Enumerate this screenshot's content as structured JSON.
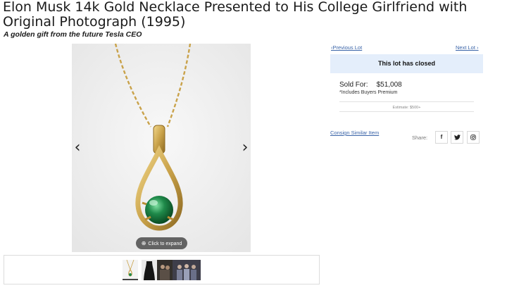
{
  "lot": {
    "title": "Elon Musk 14k Gold Necklace Presented to His College Girlfriend with Original Photograph (1995)",
    "subtitle": "A golden gift from the future Tesla CEO"
  },
  "gallery": {
    "prev_arrow": "‹",
    "next_arrow": "›",
    "expand_icon": "⊕",
    "expand_label": "Click to expand",
    "thumbnails": [
      "necklace-on-white",
      "necklace-on-bust",
      "photo-dark-1",
      "photo-group"
    ]
  },
  "sidebar": {
    "previous_lot": "Previous Lot",
    "next_lot": "Next Lot",
    "prev_chevron": "‹",
    "next_chevron": "›",
    "status": "This lot has closed",
    "sold_label": "Sold For:",
    "sold_amount": "$51,008",
    "premium_note": "*Includes Buyers Premium",
    "estimate": "Estimate: $500+",
    "consign": "Consign Similar Item",
    "share_label": "Share:",
    "share_icons": [
      "facebook-icon",
      "twitter-icon",
      "instagram-icon"
    ]
  },
  "colors": {
    "link": "#3a64a8",
    "banner_bg": "#e4eefb",
    "gold": "#c9a24a",
    "emerald": "#1f8a4a"
  }
}
